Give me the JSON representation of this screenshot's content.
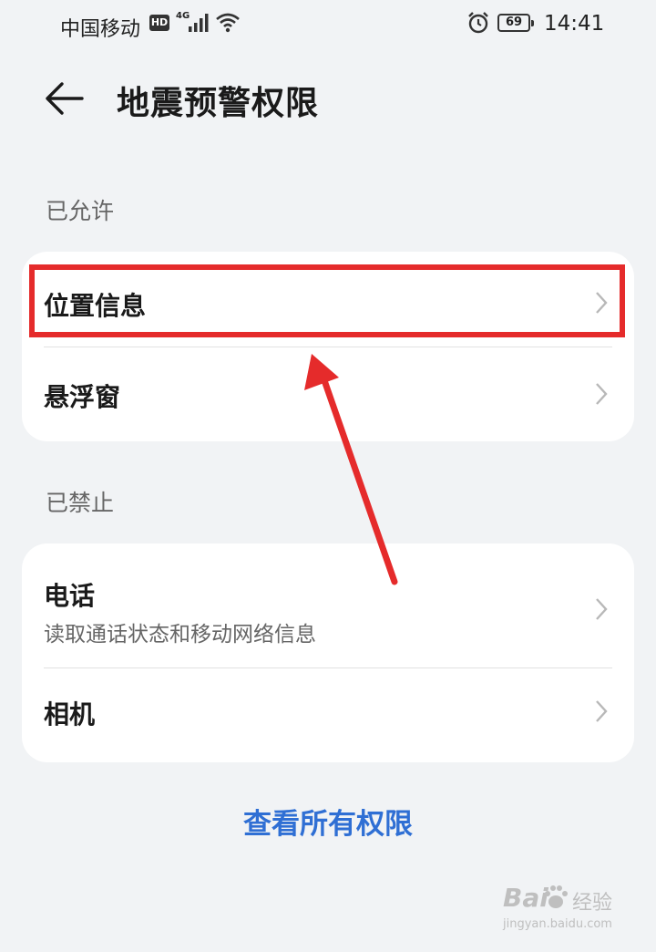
{
  "status_bar": {
    "carrier": "中国移动",
    "hd_badge": "HD",
    "network_type": "4G",
    "battery_level": "69",
    "time": "14:41",
    "icons": [
      "signal-icon",
      "wifi-icon",
      "alarm-icon",
      "battery-icon"
    ]
  },
  "header": {
    "back_icon": "back-arrow-icon",
    "title": "地震预警权限"
  },
  "allowed_section": {
    "label": "已允许",
    "items": [
      {
        "title": "位置信息",
        "icon": "chevron-right-icon"
      },
      {
        "title": "悬浮窗",
        "icon": "chevron-right-icon"
      }
    ]
  },
  "denied_section": {
    "label": "已禁止",
    "items": [
      {
        "title": "电话",
        "subtitle": "读取通话状态和移动网络信息",
        "icon": "chevron-right-icon"
      },
      {
        "title": "相机",
        "icon": "chevron-right-icon"
      }
    ]
  },
  "view_all_link": "查看所有权限",
  "annotation": {
    "highlight_color": "#e52b2b",
    "arrow_color": "#e52b2b"
  },
  "watermark": {
    "logo": "Bai",
    "logo_cn": "经验",
    "url": "jingyan.baidu.com"
  },
  "colors": {
    "background": "#f1f3f5",
    "card": "#ffffff",
    "link": "#2f6fd4"
  }
}
